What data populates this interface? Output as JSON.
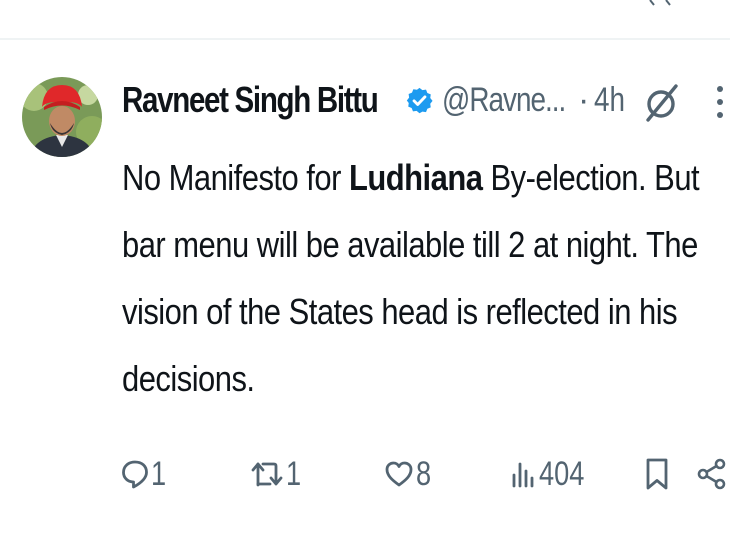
{
  "tweet": {
    "author_name": "Ravneet Singh Bittu",
    "handle": "@Ravne...",
    "separator": "·",
    "timestamp": "4h",
    "text_part1": "No Manifesto for ",
    "text_bold": "Ludhiana",
    "text_part2": " By-election. But bar menu will be available till 2 at night. The vision of the States head is reflected in his decisions."
  },
  "actions": {
    "reply_count": "1",
    "retweet_count": "1",
    "like_count": "8",
    "views_count": "404"
  },
  "icons": {
    "verified": "verified-badge-icon",
    "grok": "grok-icon",
    "more": "more-vertical-icon",
    "reply": "reply-icon",
    "retweet": "retweet-icon",
    "like": "heart-icon",
    "views": "views-icon",
    "bookmark": "bookmark-icon",
    "share": "share-icon"
  },
  "colors": {
    "text": "#0f1419",
    "secondary": "#536471",
    "verified": "#1d9bf0",
    "divider": "#eff3f4"
  }
}
